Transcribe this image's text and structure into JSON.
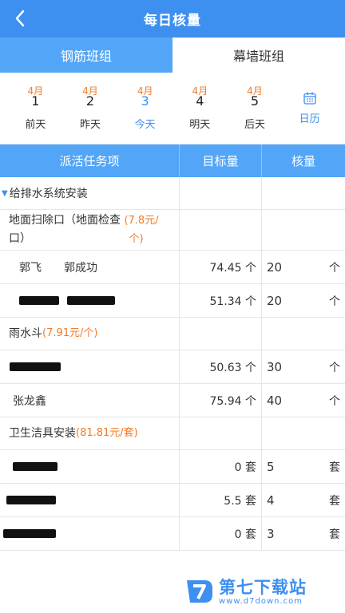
{
  "header": {
    "title": "每日核量"
  },
  "tabs": [
    {
      "label": "钢筋班组",
      "active": true
    },
    {
      "label": "幕墙班组",
      "active": false
    }
  ],
  "dates": [
    {
      "month": "4月",
      "day": "1",
      "label": "前天"
    },
    {
      "month": "4月",
      "day": "2",
      "label": "昨天"
    },
    {
      "month": "4月",
      "day": "3",
      "label": "今天"
    },
    {
      "month": "4月",
      "day": "4",
      "label": "明天"
    },
    {
      "month": "4月",
      "day": "5",
      "label": "后天"
    }
  ],
  "calendar": {
    "label": "日历"
  },
  "table": {
    "headers": {
      "task": "派活任务项",
      "target": "目标量",
      "check": "核量"
    },
    "category1": {
      "name": "给排水系统安装"
    },
    "sub1": {
      "line1": "地面扫除口（地面检查",
      "price1": "(7.8元/",
      "line2": "口）",
      "price2": "个)"
    },
    "r1": {
      "name1": "郭飞",
      "name2": "郭成功",
      "target": "74.45 个",
      "value": "20",
      "unit": "个"
    },
    "r2": {
      "target": "51.34 个",
      "value": "20",
      "unit": "个"
    },
    "sub2": {
      "name": "雨水斗",
      "price": "(7.91元/个)"
    },
    "r3": {
      "target": "50.63 个",
      "value": "30",
      "unit": "个"
    },
    "r4": {
      "name": "张龙鑫",
      "target": "75.94 个",
      "value": "40",
      "unit": "个"
    },
    "sub3": {
      "name": "卫生洁具安装",
      "price": "(81.81元/套)"
    },
    "r5": {
      "target": "0 套",
      "value": "5",
      "unit": "套"
    },
    "r6": {
      "target": "5.5 套",
      "value": "4",
      "unit": "套"
    },
    "r7": {
      "target": "0 套",
      "value": "3",
      "unit": "套"
    }
  },
  "watermark": {
    "name": "第七下载站",
    "url": "www.d7down.com"
  },
  "colors": {
    "primary": "#3d8ff0",
    "tab_active": "#53a6f7",
    "accent": "#f07a2a"
  }
}
